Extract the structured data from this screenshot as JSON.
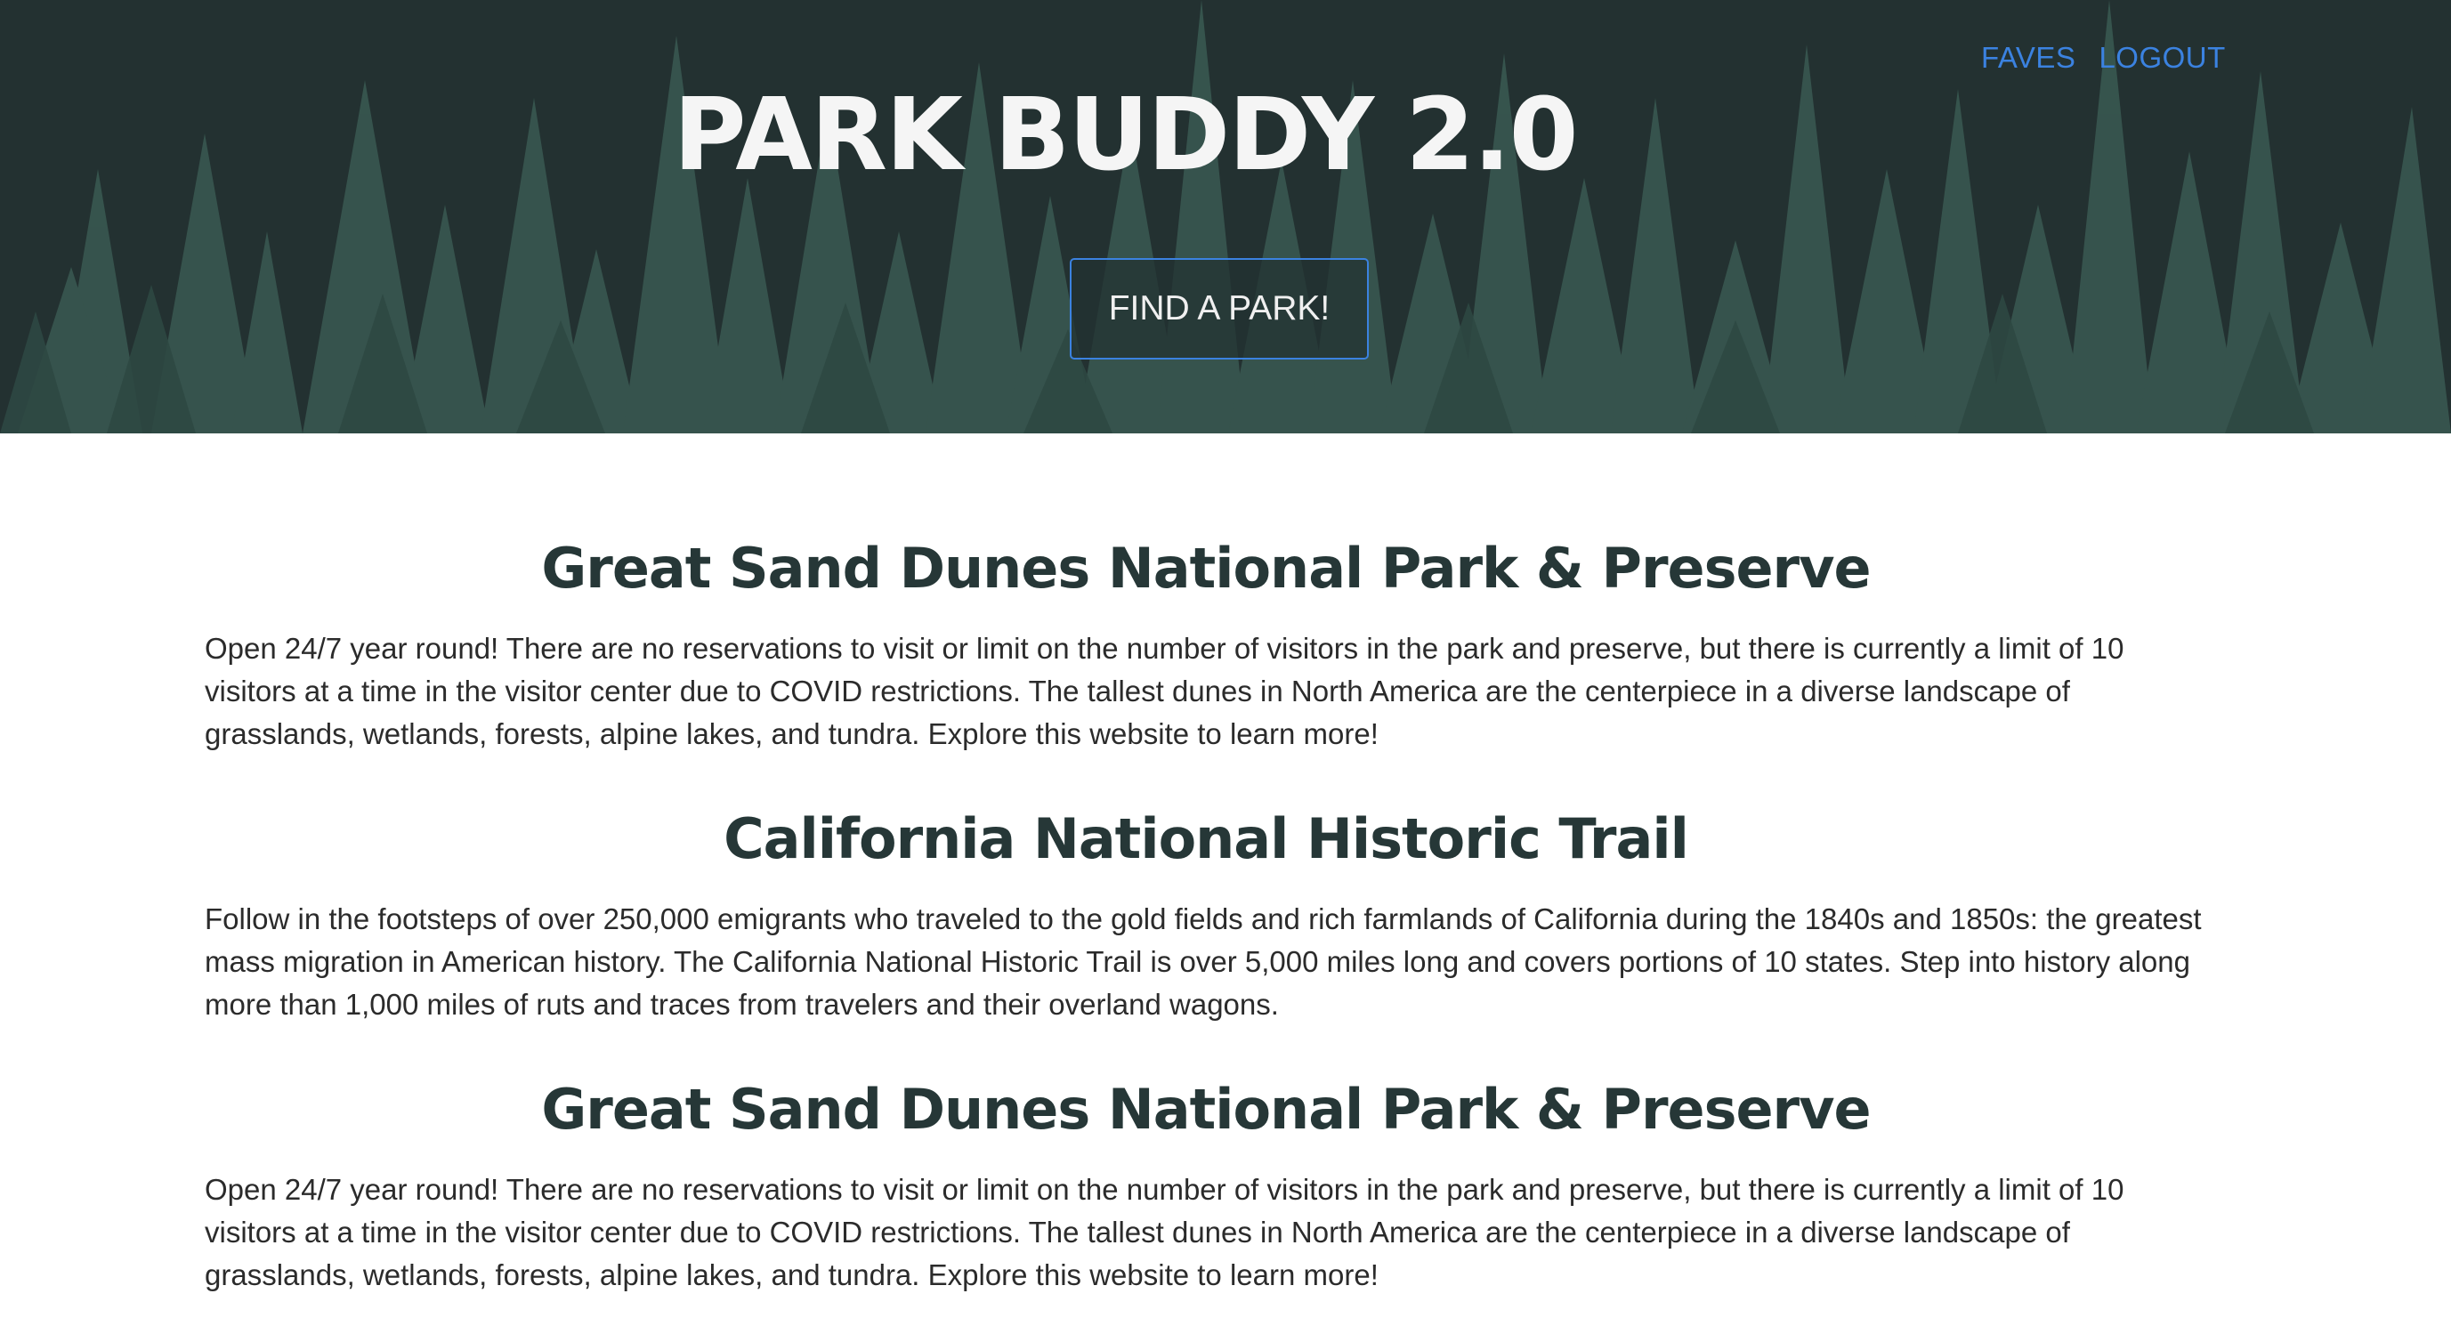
{
  "header": {
    "title": "PARK BUDDY 2.0",
    "nav": [
      {
        "label": "FAVES"
      },
      {
        "label": "LOGOUT"
      }
    ],
    "find_button_label": "FIND A PARK!"
  },
  "parks": [
    {
      "name": "Great Sand Dunes National Park & Preserve",
      "description": "Open 24/7 year round! There are no reservations to visit or limit on the number of visitors in the park and preserve, but there is currently a limit of 10 visitors at a time in the visitor center due to COVID restrictions. The tallest dunes in North America are the centerpiece in a diverse landscape of grasslands, wetlands, forests, alpine lakes, and tundra. Explore this website to learn more!"
    },
    {
      "name": "California National Historic Trail",
      "description": "Follow in the footsteps of over 250,000 emigrants who traveled to the gold fields and rich farmlands of California during the 1840s and 1850s: the greatest mass migration in American history. The California National Historic Trail is over 5,000 miles long and covers portions of 10 states. Step into history along more than 1,000 miles of ruts and traces from travelers and their overland wagons."
    },
    {
      "name": "Great Sand Dunes National Park & Preserve",
      "description": "Open 24/7 year round! There are no reservations to visit or limit on the number of visitors in the park and preserve, but there is currently a limit of 10 visitors at a time in the visitor center due to COVID restrictions. The tallest dunes in North America are the centerpiece in a diverse landscape of grasslands, wetlands, forests, alpine lakes, and tundra. Explore this website to learn more!"
    }
  ],
  "colors": {
    "hero_background": "#233131",
    "tree_color": "#3a5a52",
    "link": "#3b82e0",
    "heading": "#263737",
    "text": "#2b2b2b"
  }
}
